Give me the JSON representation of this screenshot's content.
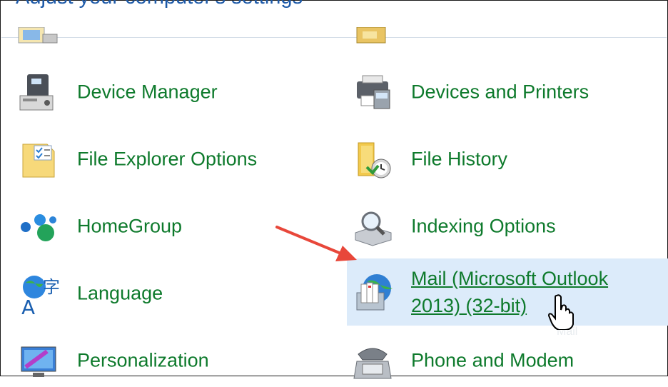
{
  "header": {
    "title": "Adjust your computer's settings"
  },
  "items": [
    {
      "label": "Device Manager"
    },
    {
      "label": "Devices and Printers"
    },
    {
      "label": "File Explorer Options"
    },
    {
      "label": "File History"
    },
    {
      "label": "HomeGroup"
    },
    {
      "label": "Indexing Options"
    },
    {
      "label": "Language"
    },
    {
      "label": "Mail (Microsoft Outlook 2013) (32-bit)"
    },
    {
      "label": "Personalization"
    },
    {
      "label": "Phone and Modem"
    }
  ],
  "ghost_text": "Mail",
  "colors": {
    "link": "#0e7a2c",
    "hover_bg": "#dcebfa",
    "arrow": "#e8473a",
    "header": "#1e5aa8"
  }
}
